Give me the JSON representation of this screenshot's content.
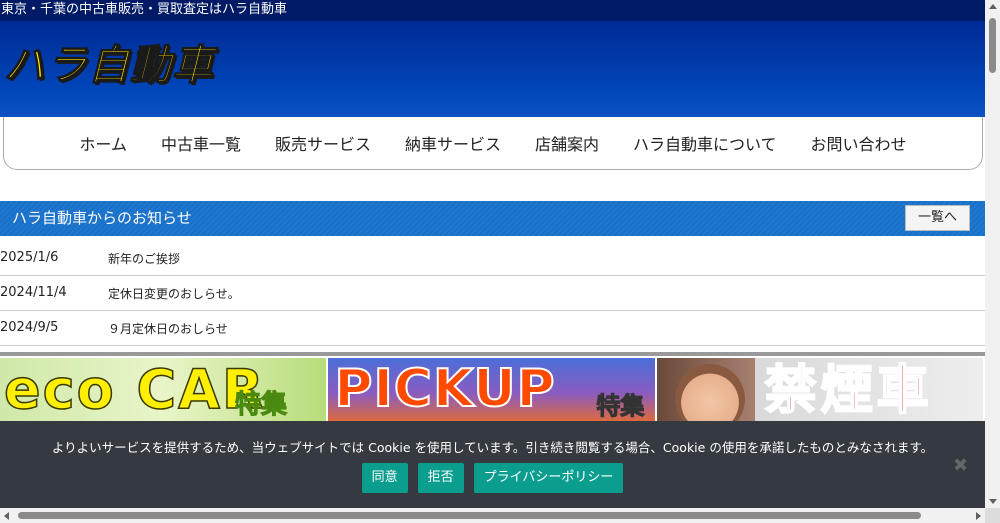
{
  "topbar": {
    "tagline": "東京・千葉の中古車販売・買取査定はハラ自動車"
  },
  "header": {
    "logo_text": "ハラ自動車"
  },
  "nav": {
    "items": [
      {
        "label": "ホーム"
      },
      {
        "label": "中古車一覧"
      },
      {
        "label": "販売サービス"
      },
      {
        "label": "納車サービス"
      },
      {
        "label": "店舗案内"
      },
      {
        "label": "ハラ自動車について"
      },
      {
        "label": "お問い合わせ"
      }
    ]
  },
  "news": {
    "title": "ハラ自動車からのお知らせ",
    "more_label": "一覧へ",
    "items": [
      {
        "date": "2025/1/6",
        "text": "新年のご挨拶"
      },
      {
        "date": "2024/11/4",
        "text": "定休日変更のおしらせ。"
      },
      {
        "date": "2024/9/5",
        "text": "９月定休日のおしらせ"
      }
    ]
  },
  "banners": {
    "eco": {
      "big": "eco CAR",
      "small": "特集"
    },
    "pickup": {
      "big": "PICKUP",
      "small": "特集"
    },
    "nonsmoking": {
      "big": "禁煙車"
    }
  },
  "cookie": {
    "message": "よりよいサービスを提供するため、当ウェブサイトでは Cookie を使用しています。引き続き閲覧する場合、Cookie の使用を承諾したものとみなされます。",
    "accept_label": "同意",
    "reject_label": "拒否",
    "privacy_label": "プライバシーポリシー",
    "close_glyph": "✖"
  },
  "colors": {
    "header_blue": "#0045b8",
    "logo_yellow": "#ffe800",
    "news_bar": "#1f78cf",
    "cookie_bg": "#343a40",
    "cookie_button": "#0b9e8f"
  }
}
